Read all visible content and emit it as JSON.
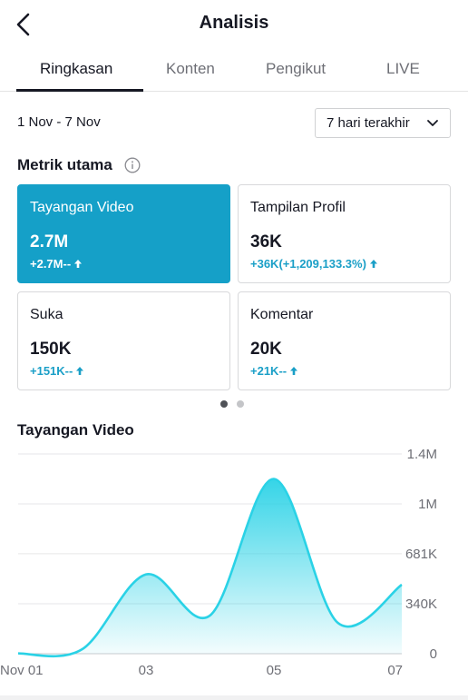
{
  "header": {
    "title": "Analisis",
    "back_icon": "chevron-left-icon"
  },
  "tabs": [
    {
      "label": "Ringkasan",
      "active": true
    },
    {
      "label": "Konten",
      "active": false
    },
    {
      "label": "Pengikut",
      "active": false
    },
    {
      "label": "LIVE",
      "active": false
    }
  ],
  "date_range": "1 Nov - 7 Nov",
  "period_select": {
    "value": "7 hari terakhir",
    "icon": "chevron-down-icon"
  },
  "metrics_section": {
    "title": "Metrik utama",
    "icon": "info-icon"
  },
  "metrics": [
    {
      "label": "Tayangan Video",
      "value": "2.7M",
      "delta": "+2.7M--",
      "selected": true
    },
    {
      "label": "Tampilan Profil",
      "value": "36K",
      "delta": "+36K(+1,209,133.3%)",
      "selected": false
    },
    {
      "label": "Suka",
      "value": "150K",
      "delta": "+151K--",
      "selected": false
    },
    {
      "label": "Komentar",
      "value": "20K",
      "delta": "+21K--",
      "selected": false
    }
  ],
  "pager": {
    "total": 2,
    "active": 0
  },
  "chart_title": "Tayangan Video",
  "colors": {
    "accent": "#15a0c8",
    "line": "#2ad2e6",
    "delta": "#1a9fc7"
  },
  "chart_data": {
    "type": "area",
    "title": "Tayangan Video",
    "x": [
      "Nov 01",
      "Nov 02",
      "Nov 03",
      "Nov 04",
      "Nov 05",
      "Nov 06",
      "Nov 07"
    ],
    "x_tick_labels": [
      "Nov 01",
      "03",
      "05",
      "07"
    ],
    "values": [
      2000,
      30000,
      540000,
      260000,
      1190000,
      210000,
      470000
    ],
    "y_tick_labels": [
      "0",
      "340K",
      "681K",
      "1M",
      "1.4M"
    ],
    "y_ticks": [
      0,
      340000,
      681000,
      1020000,
      1360000
    ],
    "ylim": [
      0,
      1360000
    ],
    "grid": true,
    "y_axis_side": "right"
  }
}
